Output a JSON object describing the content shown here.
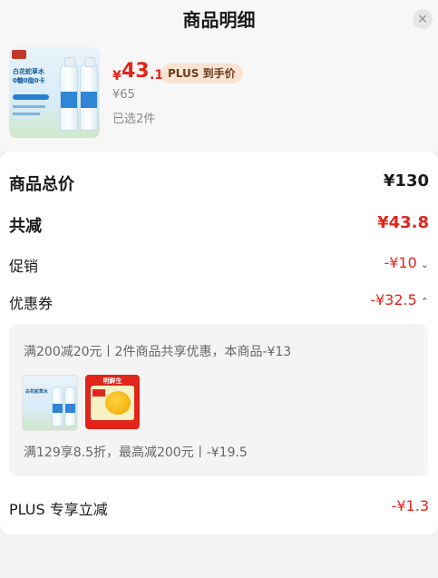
{
  "header": {
    "title": "商品明细",
    "close_icon": "×"
  },
  "product": {
    "thumb_text_line1": "白花蛇草水",
    "thumb_text_line2": "0糖0脂0卡",
    "price_symbol": "¥",
    "price_int": "43",
    "price_dec": ".1",
    "plus_badge": "PLUS 到手价",
    "original_price": "¥65",
    "selected": "已选2件"
  },
  "summary": {
    "total_label": "商品总价",
    "total_value": "¥130",
    "reduce_label": "共减",
    "reduce_value": "¥43.8",
    "promo_label": "促销",
    "promo_value": "-¥10",
    "coupon_label": "优惠券",
    "coupon_value": "-¥32.5",
    "coupon_detail_1": "满200减20元丨2件商品共享优惠，本商品-¥13",
    "coupon_detail_2": "满129享8.5折，最高减200元丨-¥19.5",
    "snack_brand": "明鲜生",
    "plus_label": "PLUS 专享立减",
    "plus_value": "-¥1.3"
  },
  "colors": {
    "accent_red": "#e1251b",
    "plus_badge_bg": "#f9e3d3",
    "plus_badge_text": "#6b3b1a"
  },
  "icons": {
    "close": "close-icon",
    "promo_chevron": "chevron-down-icon",
    "coupon_chevron": "chevron-up-icon"
  }
}
